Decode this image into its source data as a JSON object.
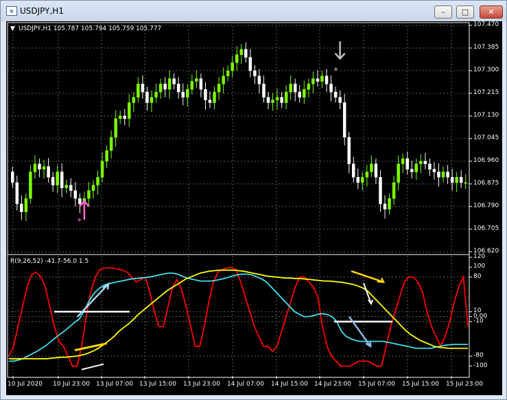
{
  "window": {
    "title": "USDJPY,H1",
    "app_icon": "chart-window-icon"
  },
  "buttons": {
    "minimize": "–",
    "maximize": "□",
    "close": "✕"
  },
  "main_header": {
    "symbol_info": "USDJPY,H1  105.787 105.794 105.759 105.777"
  },
  "indicator_header": "R(9,26,52) -41.7-56.0 1.5",
  "price_axis": [
    "107.470",
    "107.385",
    "107.300",
    "107.215",
    "107.130",
    "107.045",
    "106.960",
    "106.875",
    "106.790",
    "106.705",
    "106.620"
  ],
  "indicator_axis": [
    "120",
    "100",
    "80",
    "10",
    "0.00",
    "-10",
    "-80",
    "-100"
  ],
  "time_axis": [
    "10 Jul 2020",
    "10 Jul 23:00",
    "13 Jul 07:00",
    "13 Jul 15:00",
    "13 Jul 23:00",
    "14 Jul 07:00",
    "14 Jul 15:00",
    "14 Jul 23:00",
    "15 Jul 07:00",
    "15 Jul 15:00",
    "15 Jul 23:00"
  ],
  "colors": {
    "background": "#000000",
    "grid": "#606060",
    "bull": "#7cfc00",
    "bear": "#ffffff",
    "red_line": "#ff0000",
    "cyan_line": "#40e0f0",
    "yellow_line": "#ffff00",
    "buy_arrow": "#ff66cc",
    "sell_arrow": "#c0c0c0"
  },
  "chart_data": [
    {
      "type": "candlestick",
      "title": "USDJPY,H1",
      "ylim": [
        106.62,
        107.47
      ],
      "close": [
        106.88,
        106.8,
        106.77,
        106.82,
        106.92,
        106.95,
        106.93,
        106.94,
        106.9,
        106.87,
        106.92,
        106.86,
        106.87,
        106.85,
        106.82,
        106.8,
        106.82,
        106.85,
        106.87,
        106.9,
        106.96,
        107.0,
        107.05,
        107.12,
        107.13,
        107.12,
        107.18,
        107.2,
        107.25,
        107.22,
        107.18,
        107.2,
        107.22,
        107.25,
        107.23,
        107.27,
        107.25,
        107.22,
        107.2,
        107.23,
        107.26,
        107.27,
        107.23,
        107.19,
        107.18,
        107.22,
        107.25,
        107.28,
        107.3,
        107.33,
        107.36,
        107.38,
        107.35,
        107.3,
        107.28,
        107.25,
        107.2,
        107.18,
        107.19,
        107.2,
        107.18,
        107.22,
        107.25,
        107.22,
        107.2,
        107.23,
        107.25,
        107.27,
        107.26,
        107.28,
        107.25,
        107.22,
        107.2,
        107.18,
        107.05,
        106.95,
        106.9,
        106.88,
        106.9,
        106.92,
        106.95,
        106.9,
        106.8,
        106.78,
        106.82,
        106.88,
        106.95,
        106.97,
        106.93,
        106.92,
        106.95,
        106.96,
        106.95,
        106.93,
        106.92,
        106.9,
        106.92,
        106.9,
        106.88,
        106.9,
        106.88,
        106.88
      ]
    },
    {
      "type": "line",
      "title": "R(9,26,52)",
      "ylim": [
        -120,
        120
      ],
      "series": [
        {
          "name": "9",
          "values": [
            -80,
            -60,
            -20,
            20,
            60,
            85,
            90,
            80,
            60,
            20,
            -20,
            -50,
            -60,
            -80,
            -100,
            -100,
            -60,
            0,
            50,
            80,
            95,
            98,
            99,
            98,
            96,
            94,
            90,
            80,
            70,
            75,
            80,
            50,
            10,
            -20,
            -20,
            20,
            60,
            75,
            55,
            20,
            -20,
            -60,
            -60,
            -20,
            30,
            70,
            90,
            95,
            99,
            99,
            95,
            70,
            40,
            10,
            -20,
            -40,
            -60,
            -60,
            -70,
            -60,
            -30,
            0,
            30,
            60,
            80,
            80,
            70,
            60,
            40,
            -20,
            -60,
            -80,
            -90,
            -100,
            -100,
            -100,
            -95,
            -90,
            -90,
            -90,
            -95,
            -100,
            -100,
            -60,
            -20,
            10,
            40,
            70,
            80,
            80,
            70,
            50,
            10,
            -20,
            -40,
            -60,
            -40,
            -10,
            30,
            60,
            80,
            -20
          ]
        },
        {
          "name": "26",
          "values": [
            -90,
            -90,
            -88,
            -85,
            -80,
            -75,
            -70,
            -64,
            -58,
            -50,
            -42,
            -35,
            -28,
            -20,
            -12,
            -5,
            10,
            30,
            45,
            55,
            62,
            66,
            68,
            70,
            72,
            74,
            76,
            77,
            78,
            79,
            80,
            82,
            84,
            86,
            88,
            88,
            86,
            82,
            78,
            76,
            74,
            72,
            72,
            72,
            73,
            75,
            77,
            80,
            83,
            85,
            86,
            86,
            84,
            80,
            76,
            70,
            60,
            50,
            40,
            30,
            20,
            10,
            5,
            0,
            0,
            2,
            5,
            6,
            4,
            0,
            -10,
            -30,
            -40,
            -45,
            -48,
            -50,
            -50,
            -50,
            -50,
            -50,
            -50,
            -52,
            -54,
            -56,
            -58,
            -60,
            -62,
            -64,
            -64,
            -64,
            -64,
            -62,
            -60,
            -58,
            -57,
            -56,
            -56,
            -56,
            -56
          ]
        },
        {
          "name": "52",
          "values": [
            -85,
            -85,
            -85,
            -85,
            -85,
            -85,
            -85,
            -85,
            -85,
            -84,
            -83,
            -82,
            -82,
            -81,
            -80,
            -78,
            -76,
            -72,
            -68,
            -62,
            -55,
            -48,
            -40,
            -30,
            -22,
            -15,
            -6,
            4,
            12,
            20,
            28,
            36,
            44,
            52,
            58,
            64,
            70,
            76,
            80,
            84,
            88,
            90,
            92,
            93,
            94,
            94,
            94,
            94,
            93,
            92,
            90,
            88,
            86,
            84,
            82,
            81,
            80,
            79,
            78,
            78,
            77,
            77,
            76,
            75,
            74,
            73,
            72,
            72,
            71,
            70,
            69,
            67,
            65,
            62,
            58,
            52,
            42,
            32,
            22,
            12,
            2,
            -8,
            -18,
            -28,
            -36,
            -42,
            -48,
            -52,
            -56,
            -60,
            -62,
            -63,
            -64,
            -64,
            -64,
            -64,
            -64
          ]
        }
      ]
    }
  ]
}
